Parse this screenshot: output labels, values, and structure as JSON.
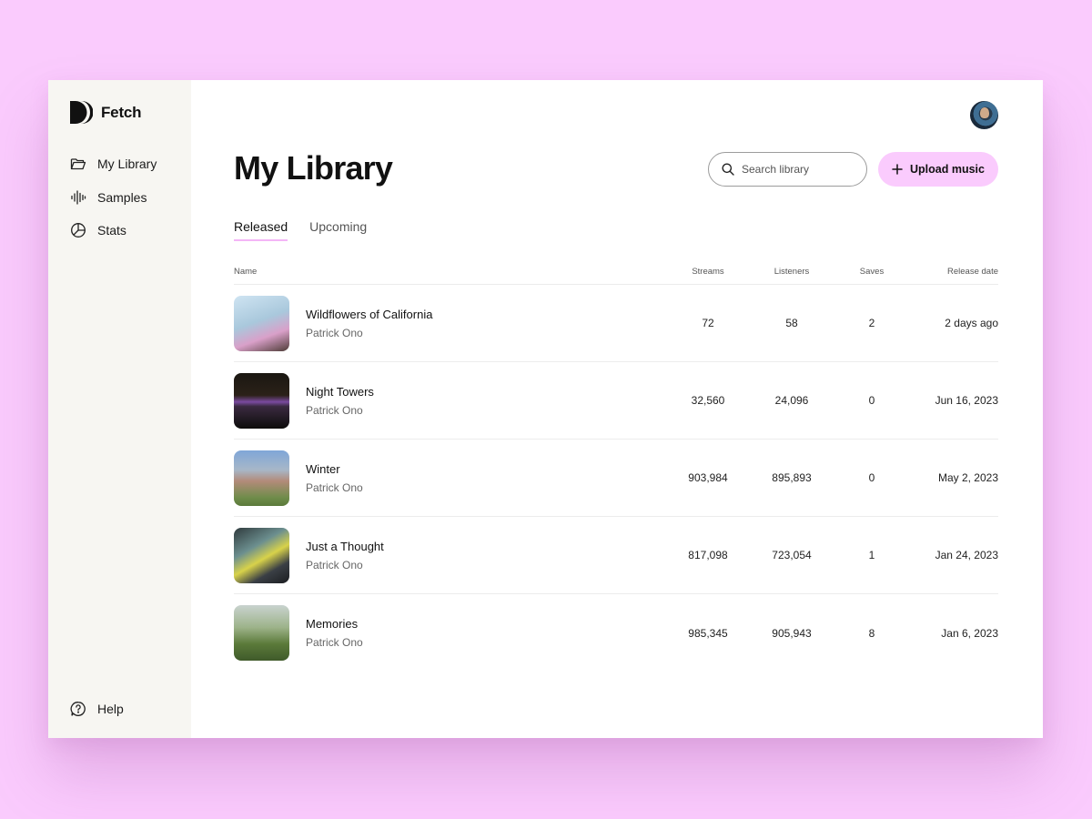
{
  "app": {
    "brand": "Fetch"
  },
  "sidebar": {
    "items": [
      {
        "label": "My Library",
        "icon": "folder-icon"
      },
      {
        "label": "Samples",
        "icon": "waveform-icon"
      },
      {
        "label": "Stats",
        "icon": "pie-chart-icon"
      }
    ],
    "help_label": "Help"
  },
  "header": {
    "title": "My Library",
    "search_placeholder": "Search library",
    "upload_label": "Upload music"
  },
  "tabs": [
    {
      "label": "Released",
      "active": true
    },
    {
      "label": "Upcoming",
      "active": false
    }
  ],
  "table": {
    "columns": {
      "name": "Name",
      "streams": "Streams",
      "listeners": "Listeners",
      "saves": "Saves",
      "release_date": "Release date"
    },
    "rows": [
      {
        "title": "Wildflowers of California",
        "artist": "Patrick Ono",
        "streams": "72",
        "listeners": "58",
        "saves": "2",
        "release_date": "2 days ago"
      },
      {
        "title": "Night Towers",
        "artist": "Patrick Ono",
        "streams": "32,560",
        "listeners": "24,096",
        "saves": "0",
        "release_date": "Jun 16, 2023"
      },
      {
        "title": "Winter",
        "artist": "Patrick Ono",
        "streams": "903,984",
        "listeners": "895,893",
        "saves": "0",
        "release_date": "May 2, 2023"
      },
      {
        "title": "Just a Thought",
        "artist": "Patrick Ono",
        "streams": "817,098",
        "listeners": "723,054",
        "saves": "1",
        "release_date": "Jan 24, 2023"
      },
      {
        "title": "Memories",
        "artist": "Patrick Ono",
        "streams": "985,345",
        "listeners": "905,943",
        "saves": "8",
        "release_date": "Jan 6, 2023"
      }
    ]
  },
  "colors": {
    "background": "#facbfd",
    "sidebar": "#f7f6f2",
    "accent": "#facbfd",
    "tab_underline": "#f4b6f7"
  }
}
